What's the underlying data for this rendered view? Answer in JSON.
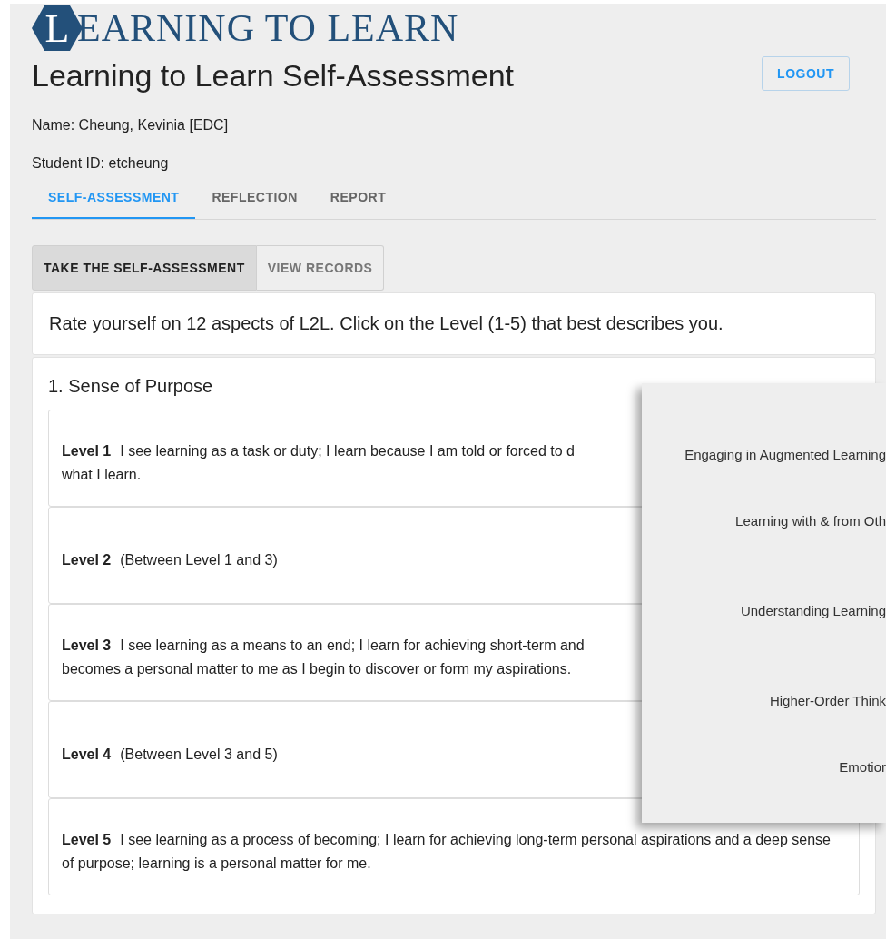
{
  "logo": {
    "initial": "L",
    "rest": "EARNING TO LEARN"
  },
  "title": "Learning to Learn Self-Assessment",
  "logout_button": "LOGOUT",
  "user": {
    "name": "Name: Cheung, Kevinia [EDC]",
    "student_id": "Student ID: etcheung"
  },
  "tabs": [
    {
      "label": "SELF-ASSESSMENT",
      "selected": true
    },
    {
      "label": "REFLECTION",
      "selected": false
    },
    {
      "label": "REPORT",
      "selected": false
    }
  ],
  "sub_tabs": [
    {
      "label": "TAKE THE SELF-ASSESSMENT",
      "selected": true
    },
    {
      "label": "VIEW RECORDS",
      "selected": false
    }
  ],
  "instruction": "Rate yourself on 12 aspects of L2L. Click on the Level (1-5) that best describes you.",
  "section": {
    "title": "1. Sense of Purpose",
    "levels": [
      {
        "label": "Level 1",
        "lines": [
          "I see learning as a task or duty; I learn because I am told or forced to d",
          "what I learn."
        ]
      },
      {
        "label": "Level 2",
        "lines": [
          "(Between Level 1 and 3)"
        ]
      },
      {
        "label": "Level 3",
        "lines": [
          "I see learning as a means to an end; I learn for achieving short-term and",
          "becomes a personal matter to me as I begin to discover or form my aspirations."
        ]
      },
      {
        "label": "Level 4",
        "lines": [
          "(Between Level 3 and 5)"
        ]
      },
      {
        "label": "Level 5",
        "lines": [
          "I see learning as a process of becoming; I learn for achieving long-term personal aspirations and a deep sense of purpose; learning is a personal matter for me."
        ]
      }
    ]
  },
  "popup": {
    "items": [
      "Engaging in Augmented Learning",
      "Learning with & from Oth",
      "Understanding Learning",
      "Higher-Order Think",
      "Emotior"
    ]
  }
}
